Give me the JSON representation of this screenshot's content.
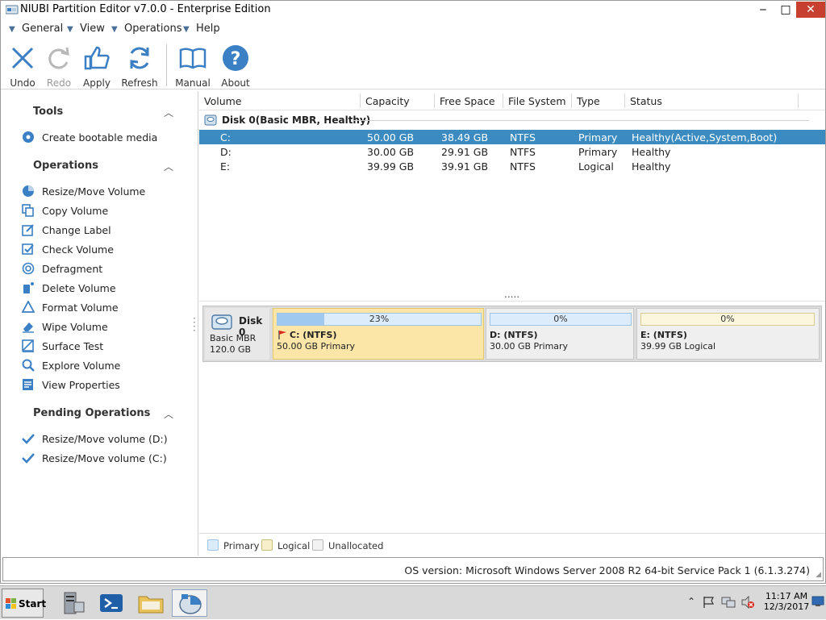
{
  "window": {
    "title": "NIUBI Partition Editor v7.0.0 - Enterprise Edition",
    "minimize": "‒",
    "maximize": "□",
    "close": "✕"
  },
  "menu": {
    "items": [
      {
        "label": "General"
      },
      {
        "label": "View"
      },
      {
        "label": "Operations"
      },
      {
        "label": "Help"
      }
    ]
  },
  "toolbar": {
    "undo": "Undo",
    "redo": "Redo",
    "apply": "Apply",
    "refresh": "Refresh",
    "manual": "Manual",
    "about": "About"
  },
  "sidebar": {
    "tools_title": "Tools",
    "tools": [
      {
        "label": "Create bootable media",
        "icon": "disc-icon"
      }
    ],
    "operations_title": "Operations",
    "operations": [
      {
        "label": "Resize/Move Volume",
        "icon": "pie-icon"
      },
      {
        "label": "Copy Volume",
        "icon": "copy-icon"
      },
      {
        "label": "Change Label",
        "icon": "edit-icon"
      },
      {
        "label": "Check Volume",
        "icon": "check-box-icon"
      },
      {
        "label": "Defragment",
        "icon": "defrag-icon"
      },
      {
        "label": "Delete Volume",
        "icon": "delete-icon"
      },
      {
        "label": "Format Volume",
        "icon": "format-icon"
      },
      {
        "label": "Wipe Volume",
        "icon": "eraser-icon"
      },
      {
        "label": "Surface Test",
        "icon": "surface-test-icon"
      },
      {
        "label": "Explore Volume",
        "icon": "magnifier-icon"
      },
      {
        "label": "View Properties",
        "icon": "properties-icon"
      }
    ],
    "pending_title": "Pending Operations",
    "pending": [
      {
        "label": "Resize/Move volume (D:)"
      },
      {
        "label": "Resize/Move volume (C:)"
      }
    ]
  },
  "table": {
    "headers": {
      "volume": "Volume",
      "capacity": "Capacity",
      "free": "Free Space",
      "fs": "File System",
      "type": "Type",
      "status": "Status"
    },
    "disk_label": "Disk 0(Basic MBR, Healthy)",
    "rows": [
      {
        "volume": "C:",
        "capacity": "50.00 GB",
        "free": "38.49 GB",
        "fs": "NTFS",
        "type": "Primary",
        "status": "Healthy(Active,System,Boot)"
      },
      {
        "volume": "D:",
        "capacity": "30.00 GB",
        "free": "29.91 GB",
        "fs": "NTFS",
        "type": "Primary",
        "status": "Healthy"
      },
      {
        "volume": "E:",
        "capacity": "39.99 GB",
        "free": "39.91 GB",
        "fs": "NTFS",
        "type": "Logical",
        "status": "Healthy"
      }
    ],
    "splitter": "....."
  },
  "diskmap": {
    "name": "Disk 0",
    "style": "Basic MBR",
    "size": "120.0 GB",
    "partitions": [
      {
        "pct": "23%",
        "used_fraction": 0.23,
        "name": "C: (NTFS)",
        "detail": "50.00 GB Primary"
      },
      {
        "pct": "0%",
        "used_fraction": 0.0,
        "name": "D: (NTFS)",
        "detail": "30.00 GB Primary"
      },
      {
        "pct": "0%",
        "used_fraction": 0.0,
        "name": "E: (NTFS)",
        "detail": "39.99 GB Logical"
      }
    ]
  },
  "legend": {
    "primary": "Primary",
    "logical": "Logical",
    "unallocated": "Unallocated"
  },
  "status": {
    "os": "OS version: Microsoft Windows Server 2008 R2  64-bit Service Pack 1 (6.1.3.274)"
  },
  "taskbar": {
    "start": "Start",
    "time": "11:17 AM",
    "date": "12/3/2017",
    "tray_expand": "⌃"
  },
  "colors": {
    "selection": "#3c8bc0",
    "accent_blue": "#3b7fc4",
    "close_red": "#c7402f",
    "selected_partition": "#fbe6a8"
  }
}
